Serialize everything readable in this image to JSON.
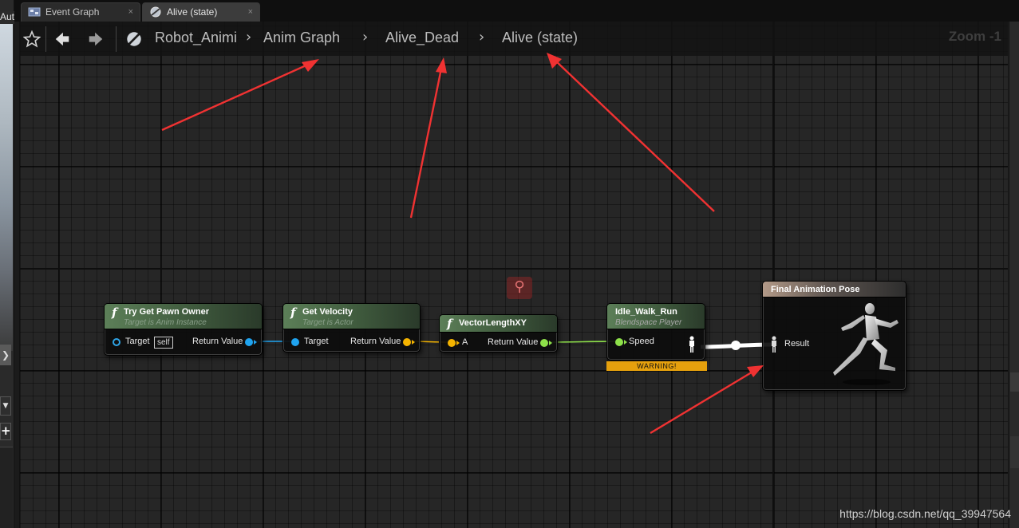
{
  "tabs": [
    {
      "label": "Event Graph",
      "icon": "event-graph-icon",
      "close": "×"
    },
    {
      "label": "Alive (state)",
      "icon": "state-icon",
      "close": "×"
    }
  ],
  "sidebar": {
    "cut_text": "Aut"
  },
  "breadcrumbs": [
    "Robot_Animi",
    "Anim Graph",
    "Alive_Dead",
    "Alive (state)"
  ],
  "zoom": "Zoom -1",
  "nodes": {
    "try_get_pawn_owner": {
      "title": "Try Get Pawn Owner",
      "subtitle": "Target is Anim Instance",
      "target_label": "Target",
      "self_label": "self",
      "return_label": "Return Value"
    },
    "get_velocity": {
      "title": "Get Velocity",
      "subtitle": "Target is Actor",
      "target_label": "Target",
      "return_label": "Return Value"
    },
    "vector_length_xy": {
      "title": "VectorLengthXY",
      "a_label": "A",
      "return_label": "Return Value"
    },
    "idle_walk_run": {
      "title": "Idle_Walk_Run",
      "subtitle": "Blendspace Player",
      "speed_label": "Speed",
      "warning": "WARNING!"
    },
    "final_animation_pose": {
      "title": "Final Animation Pose",
      "result_label": "Result"
    }
  },
  "function_glyph": "f",
  "pin_colors": {
    "object": "#1fa3ef",
    "vector": "#f5b400",
    "float": "#8ee14a",
    "pose": "#ffffff"
  },
  "annotation_color": "#f03232",
  "watermark": "https://blog.csdn.net/qq_39947564"
}
